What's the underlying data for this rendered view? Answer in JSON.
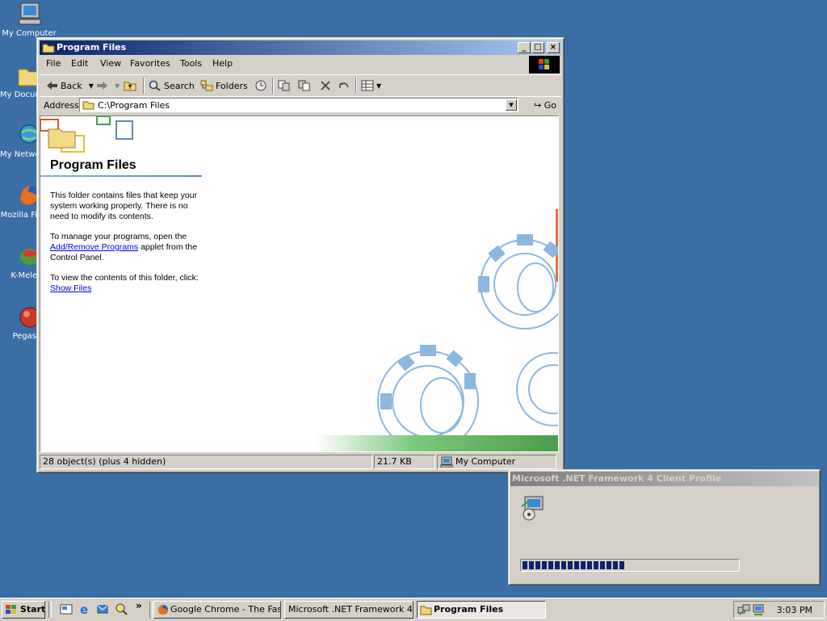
{
  "desktop": {
    "icons": [
      {
        "name": "my-computer",
        "label": "My Computer",
        "icon": "computer-icon"
      },
      {
        "name": "my-documents",
        "label": "My Documents",
        "icon": "folder-icon"
      },
      {
        "name": "my-network-places",
        "label": "My Network Places",
        "icon": "network-globe-icon"
      },
      {
        "name": "mozilla-firefox",
        "label": "Mozilla Firefox",
        "icon": "firefox-icon"
      },
      {
        "name": "k-meleon",
        "label": "K-Meleon",
        "icon": "k-meleon-icon"
      },
      {
        "name": "pegasus",
        "label": "Pegasus",
        "icon": "pegasus-icon"
      }
    ],
    "background_color": "#3a6ea5"
  },
  "explorer": {
    "title": "Program Files",
    "menu": [
      "File",
      "Edit",
      "View",
      "Favorites",
      "Tools",
      "Help"
    ],
    "toolbar": {
      "back": "Back",
      "search": "Search",
      "folders": "Folders"
    },
    "address": {
      "label": "Address",
      "value": "C:\\Program Files",
      "go": "Go"
    },
    "content": {
      "heading": "Program Files",
      "para1": "This folder contains files that keep your system working properly. There is no need to modify its contents.",
      "para2_pre": "To manage your programs, open the",
      "para2_link": "Add/Remove Programs",
      "para2_post": "applet from the Control Panel.",
      "para3_pre": "To view the contents of this folder, click:",
      "para3_link": "Show Files"
    },
    "status": {
      "objects": "28 object(s) (plus 4 hidden)",
      "size": "21.7 KB",
      "zone": "My Computer"
    }
  },
  "installer": {
    "title": "Microsoft .NET Framework 4 Client Profile",
    "progress_fraction": 0.48,
    "progress_color": "#0a246a"
  },
  "taskbar": {
    "start": "Start",
    "tasks": [
      {
        "label": "Google Chrome - The Fas...",
        "icon": "firefox-icon",
        "active": false
      },
      {
        "label": "Microsoft .NET Framework 4 ...",
        "icon": "none",
        "active": false
      },
      {
        "label": "Program Files",
        "icon": "folder-icon",
        "active": true
      }
    ],
    "clock": "3:03 PM"
  }
}
